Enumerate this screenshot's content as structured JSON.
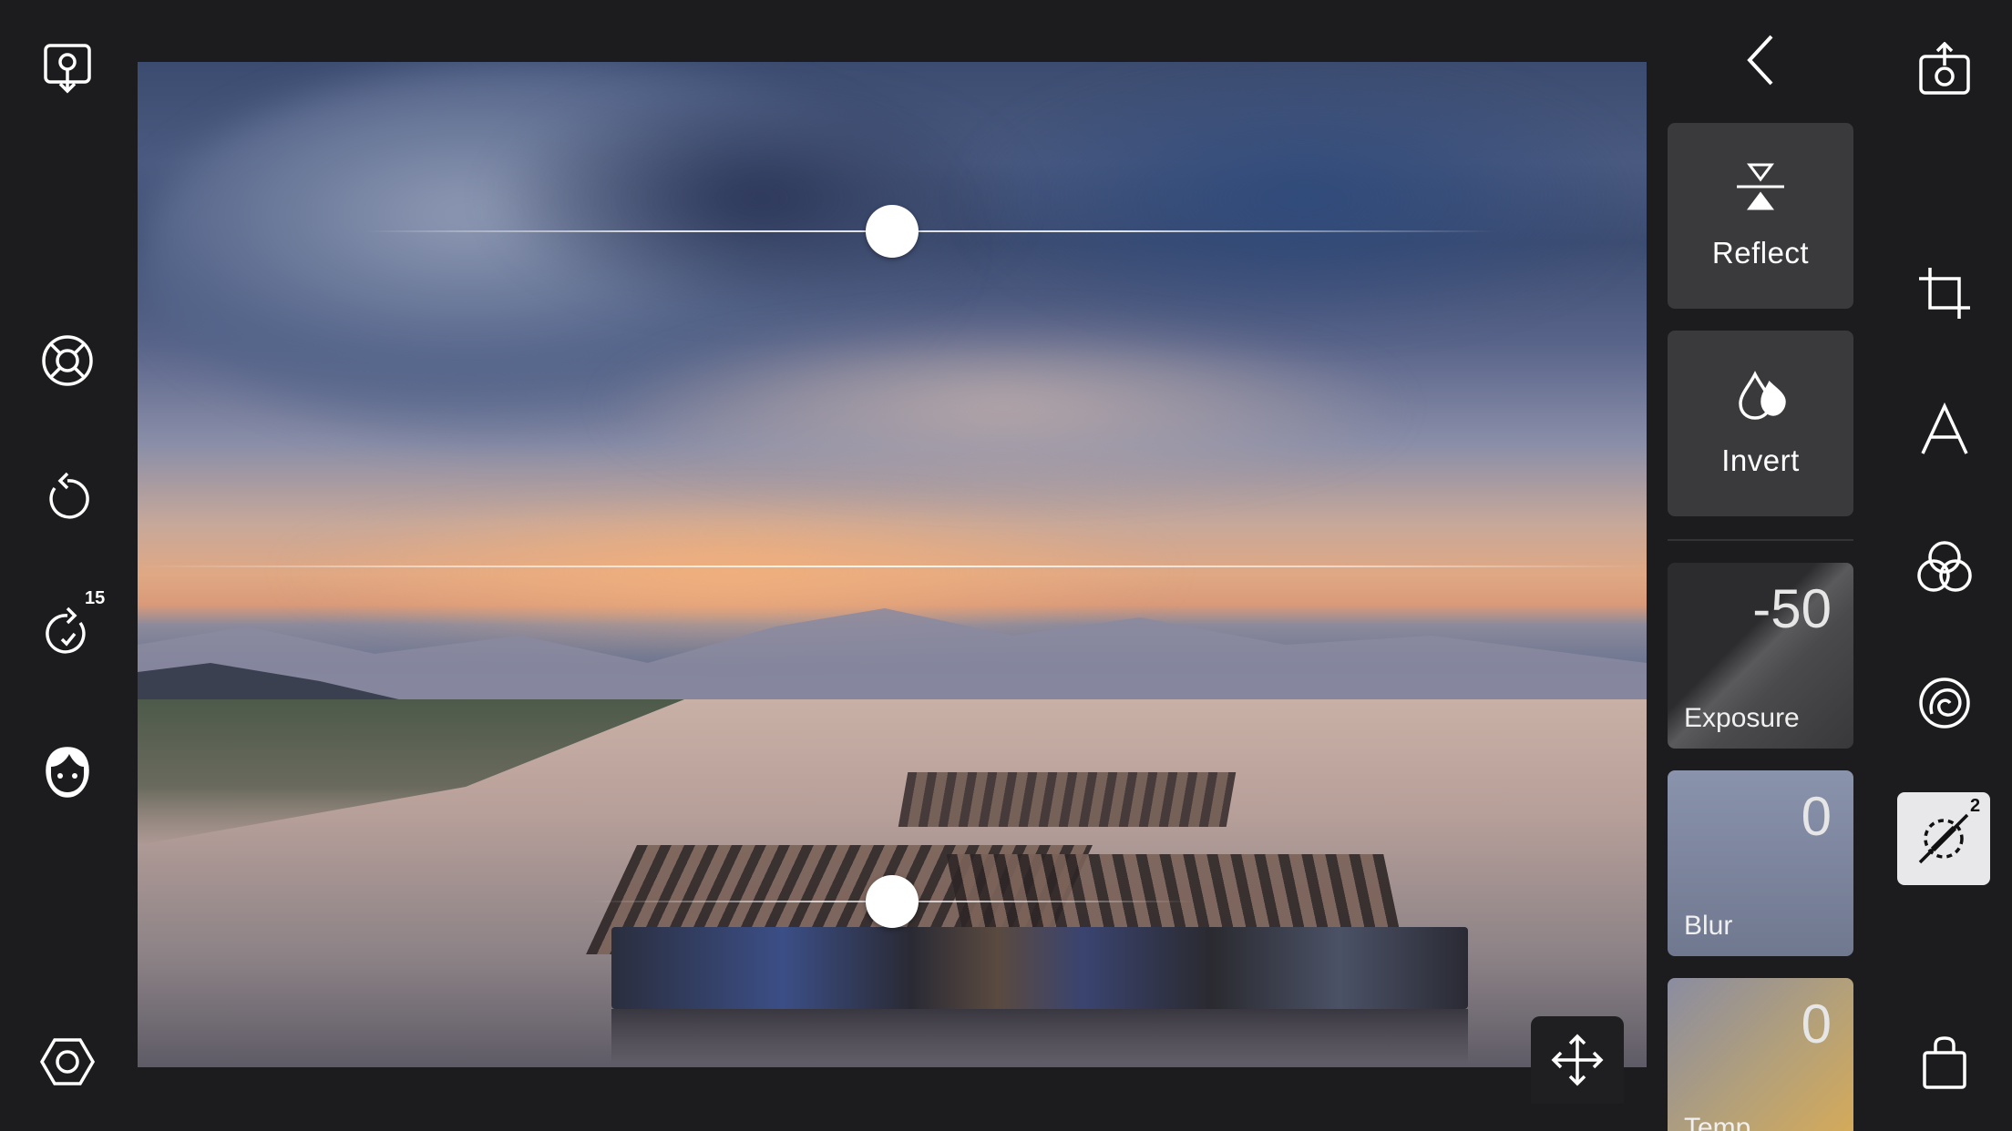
{
  "left_toolbar": {
    "items": [
      {
        "name": "import-photo",
        "icon": "download-pin-icon"
      },
      {
        "name": "help",
        "icon": "lifebuoy-icon"
      },
      {
        "name": "undo",
        "icon": "undo-icon"
      },
      {
        "name": "redo",
        "icon": "redo-icon",
        "badge": "15"
      },
      {
        "name": "face",
        "icon": "face-icon"
      },
      {
        "name": "settings",
        "icon": "hexagon-settings-icon"
      }
    ]
  },
  "photo": {
    "description_icon": "move-arrows-icon"
  },
  "panel": {
    "back_icon": "chevron-left-icon",
    "reflect_label": "Reflect",
    "invert_label": "Invert",
    "params": [
      {
        "label": "Exposure",
        "value": "-50"
      },
      {
        "label": "Blur",
        "value": "0"
      },
      {
        "label": "Temp",
        "value": "0"
      }
    ]
  },
  "right_toolbar": {
    "items": [
      {
        "name": "share",
        "icon": "camera-share-icon"
      },
      {
        "name": "crop",
        "icon": "crop-icon"
      },
      {
        "name": "text",
        "icon": "text-a-icon"
      },
      {
        "name": "filters",
        "icon": "color-circles-icon"
      },
      {
        "name": "vignette",
        "icon": "spiral-icon"
      },
      {
        "name": "gradient",
        "icon": "gradient-tool-icon",
        "badge": "2"
      },
      {
        "name": "export",
        "icon": "shopping-bag-icon"
      }
    ]
  },
  "colors": {
    "background": "#1c1c1e",
    "tile": "#3a3a3c",
    "active_tool": "#e8e8ea"
  }
}
